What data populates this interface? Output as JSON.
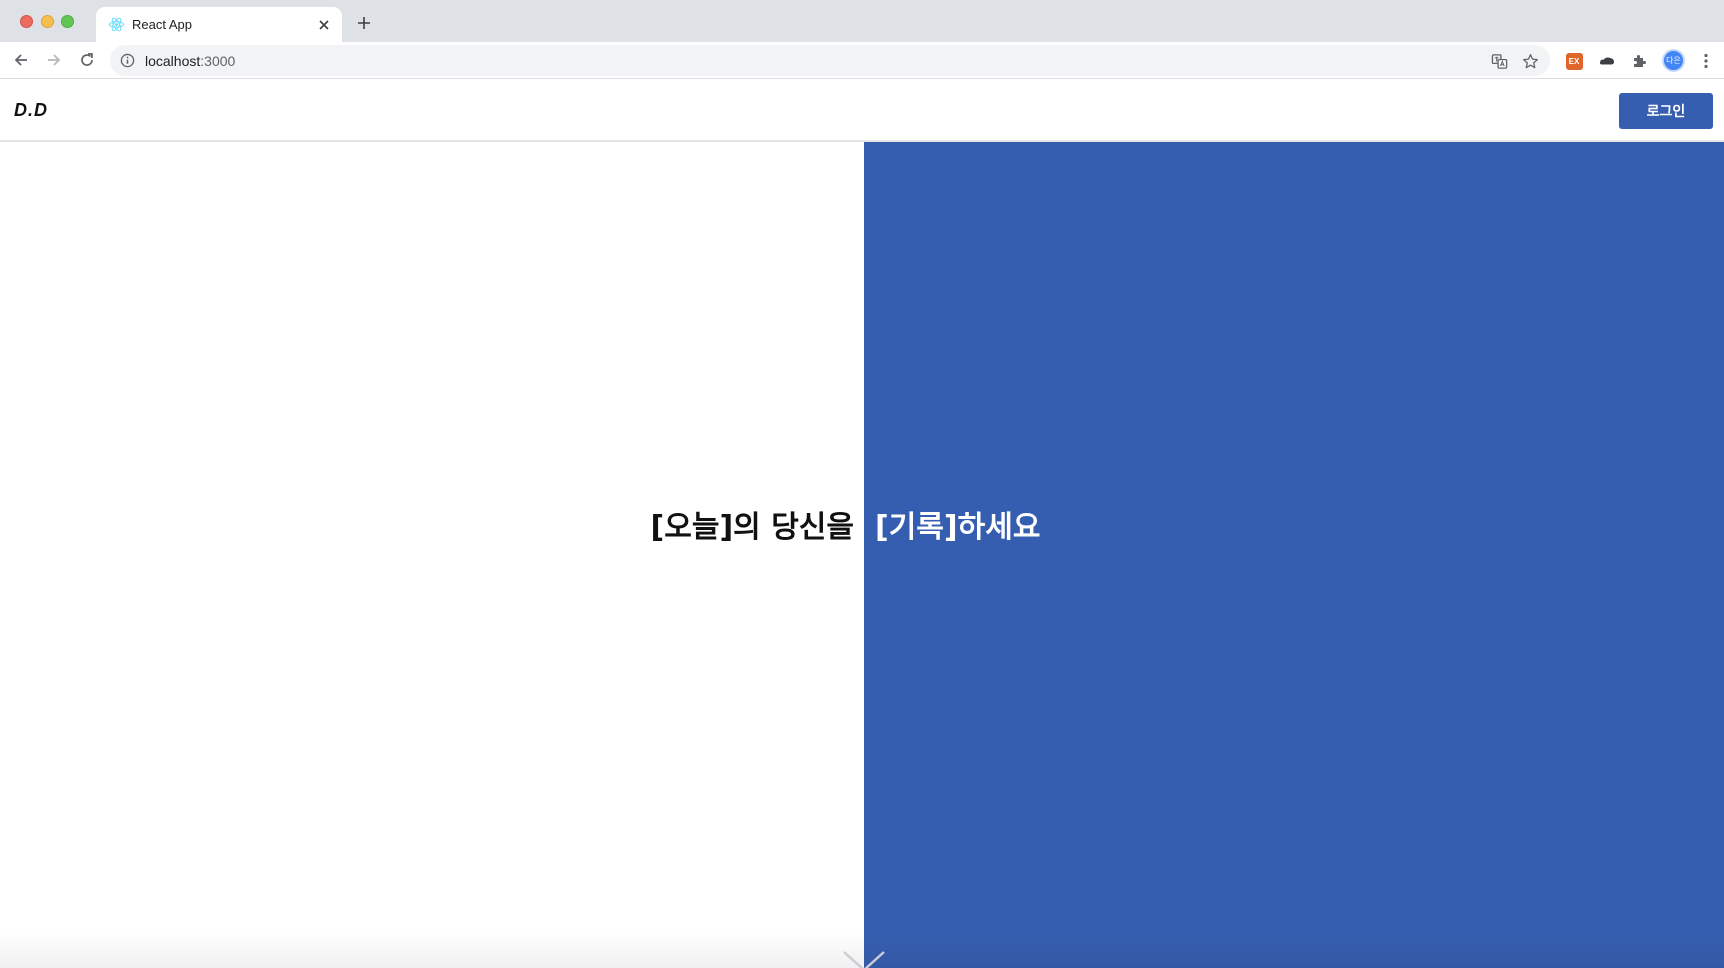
{
  "browser": {
    "tab": {
      "title": "React App",
      "favicon": "react-logo-icon",
      "close_icon": "close-icon"
    },
    "new_tab_icon": "plus-icon",
    "nav": {
      "back_icon": "back-arrow-icon",
      "forward_icon": "forward-arrow-icon",
      "reload_icon": "reload-icon"
    },
    "address": {
      "host": "localhost",
      "port": ":3000",
      "info_icon": "info-icon"
    },
    "actions": {
      "translate_icon": "translate-icon",
      "bookmark_icon": "star-icon"
    },
    "extensions": {
      "ex_label": "EX",
      "profile_label": "다은"
    }
  },
  "app": {
    "logo": "D.D",
    "login_label": "로그인",
    "headline_left": "[오늘]의 당신을",
    "headline_right": "[기록]하세요",
    "scroll_icon": "double-chevron-down-icon",
    "colors": {
      "primary": "#365eb0",
      "background": "#ffffff",
      "text": "#111111"
    }
  }
}
